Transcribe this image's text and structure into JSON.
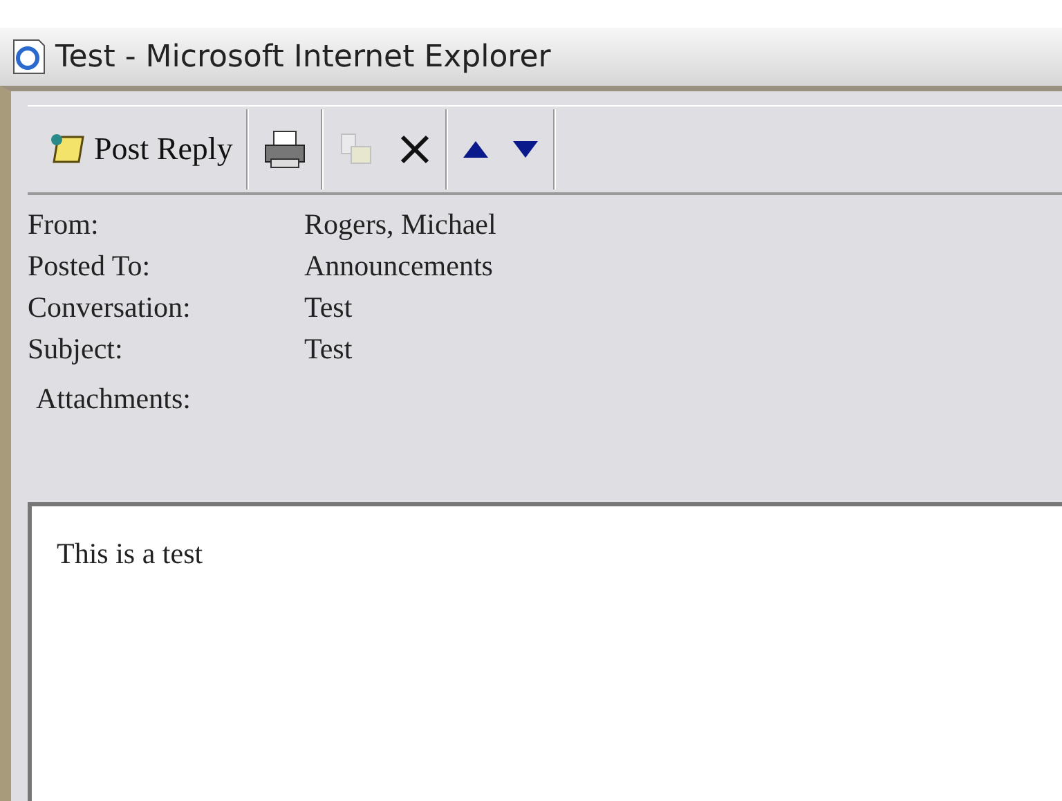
{
  "window": {
    "title": "Test - Microsoft Internet Explorer"
  },
  "toolbar": [
    {
      "kind": "reply",
      "label": "Post Reply",
      "disabled": false
    },
    {
      "kind": "print",
      "disabled": false
    },
    {
      "kind": "copy",
      "disabled": true
    },
    {
      "kind": "delete",
      "disabled": false
    },
    {
      "kind": "up",
      "disabled": false
    },
    {
      "kind": "down",
      "disabled": false
    }
  ],
  "fields": [
    {
      "label": "From:",
      "value": "Rogers, Michael"
    },
    {
      "label": "Posted To:",
      "value": "Announcements"
    },
    {
      "label": "Conversation:",
      "value": "Test"
    },
    {
      "label": "Subject:",
      "value": "Test"
    },
    {
      "label": "Attachments:"
    }
  ],
  "message": {
    "body": "This is a test"
  }
}
